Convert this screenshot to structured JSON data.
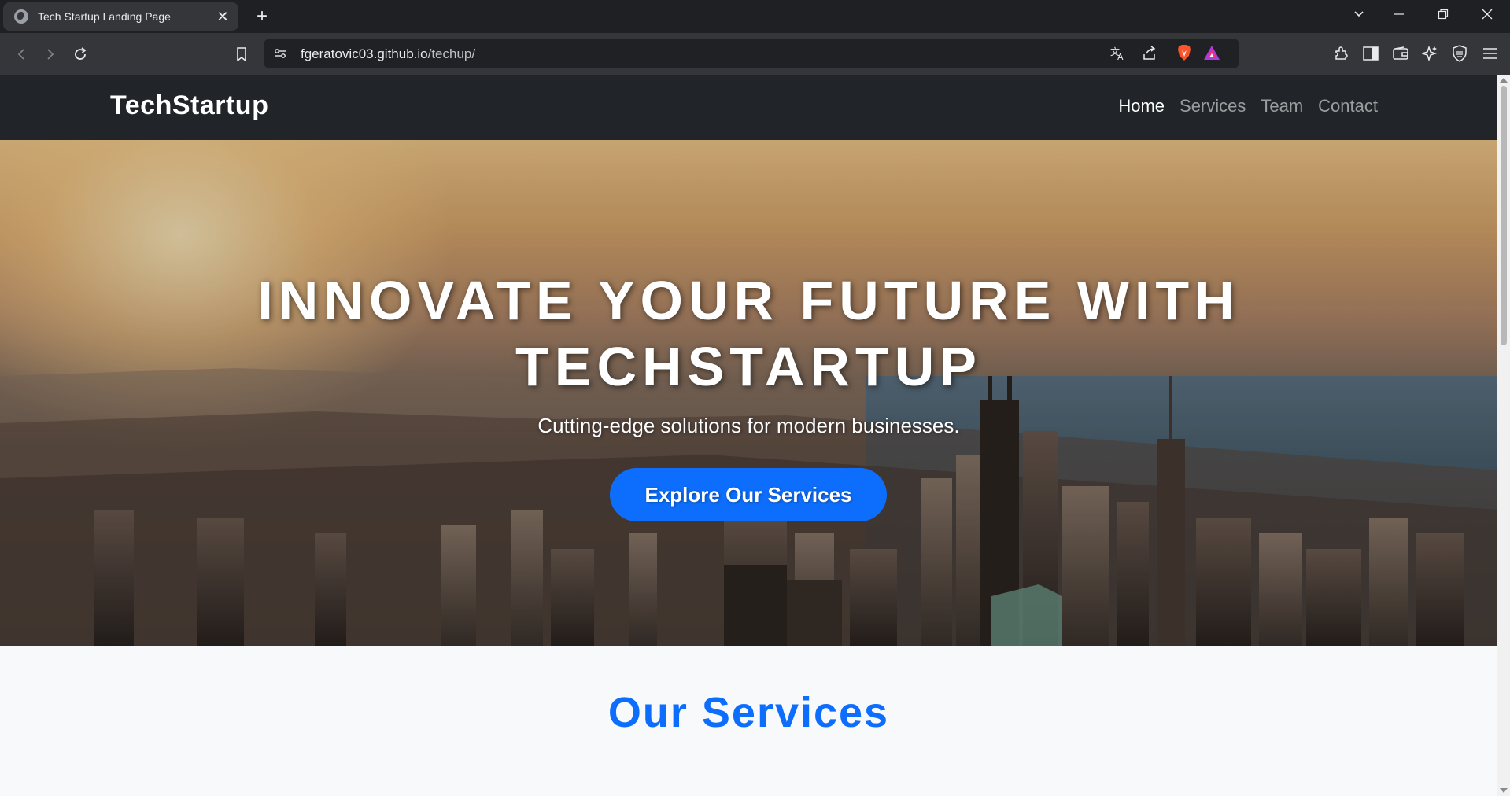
{
  "browser": {
    "tab_title": "Tech Startup Landing Page",
    "url_host": "fgeratovic03.github.io",
    "url_path": "/techup/"
  },
  "site": {
    "brand": "TechStartup",
    "nav": [
      "Home",
      "Services",
      "Team",
      "Contact"
    ],
    "active_nav": "Home"
  },
  "hero": {
    "title_line1": "Innovate Your Future with",
    "title_line2": "TechStartup",
    "subtitle": "Cutting-edge solutions for modern businesses.",
    "cta_label": "Explore Our Services"
  },
  "services": {
    "heading": "Our Services"
  },
  "colors": {
    "primary": "#0d6efd",
    "navbar": "#212529",
    "section_bg": "#f8f9fa"
  }
}
